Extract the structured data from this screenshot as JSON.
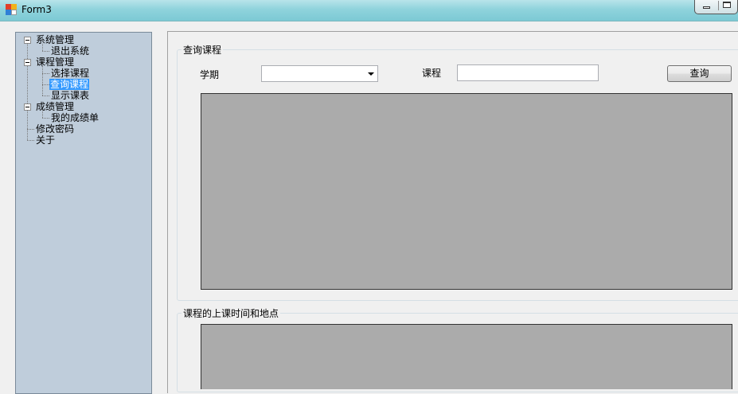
{
  "window": {
    "title": "Form3"
  },
  "tree": {
    "nodes": [
      {
        "label": "系统管理"
      },
      {
        "label": "退出系统"
      },
      {
        "label": "课程管理"
      },
      {
        "label": "选择课程"
      },
      {
        "label": "查询课程"
      },
      {
        "label": "显示课表"
      },
      {
        "label": "成绩管理"
      },
      {
        "label": "我的成绩单"
      },
      {
        "label": "修改密码"
      },
      {
        "label": "关于"
      }
    ],
    "selected": "查询课程"
  },
  "query_group": {
    "title": "查询课程",
    "term_label": "学期",
    "term_value": "",
    "course_label": "课程",
    "course_value": "",
    "search_button": "查询"
  },
  "schedule_group": {
    "title": "课程的上课时间和地点"
  },
  "colors": {
    "titlebar": "#8fd3dc",
    "tree_background": "#bfcddb",
    "selection": "#3399ff",
    "grid_background": "#ababab"
  }
}
